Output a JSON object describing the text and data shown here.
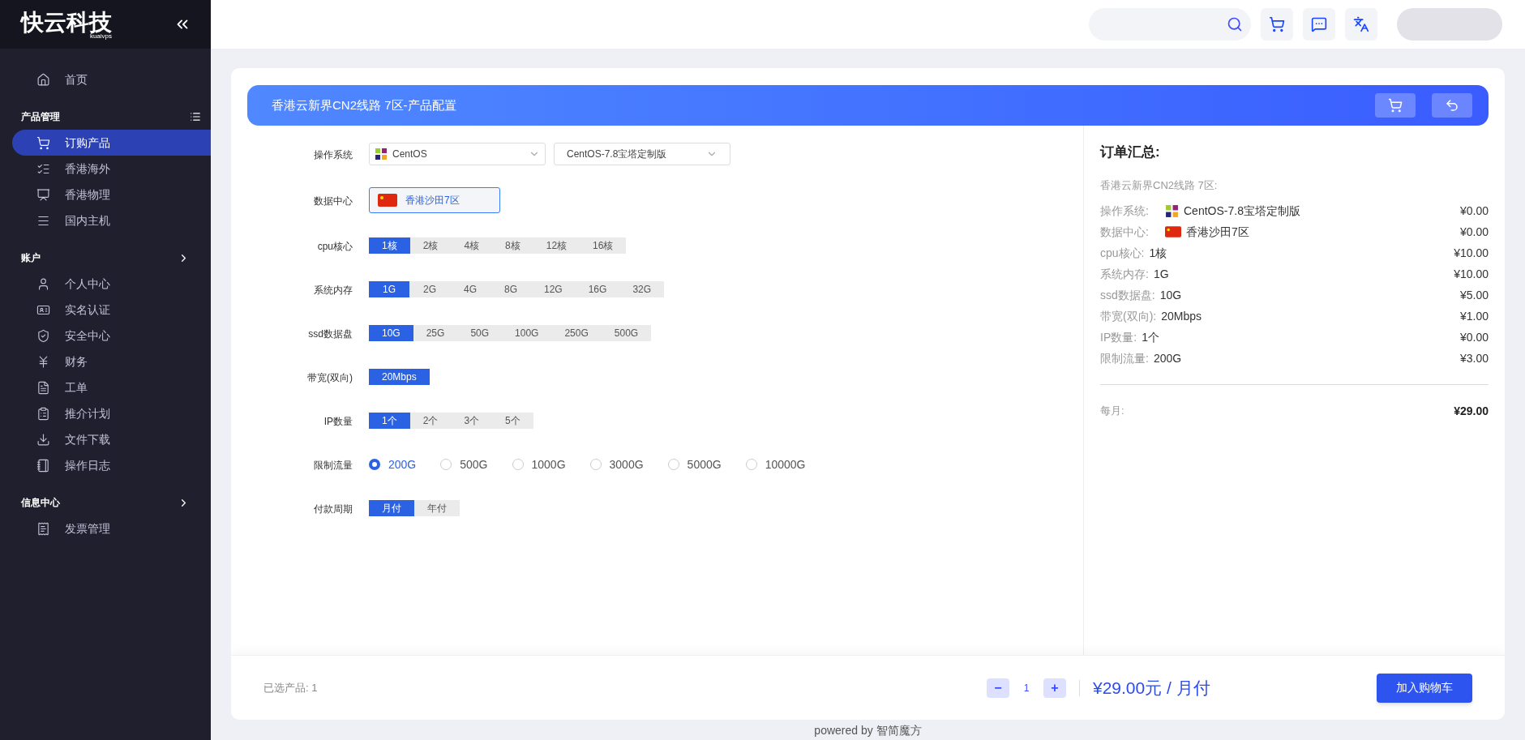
{
  "sidebar": {
    "logo": {
      "text": "快云科技",
      "subtitle": "kuaivps"
    },
    "sections": [
      {
        "items": [
          {
            "label": "首页",
            "selected": false
          }
        ]
      },
      {
        "title": "产品管理",
        "kind": "list",
        "items": [
          {
            "label": "订购产品",
            "selected": true
          },
          {
            "label": "香港海外",
            "selected": false
          },
          {
            "label": "香港物理",
            "selected": false
          },
          {
            "label": "国内主机",
            "selected": false
          }
        ]
      },
      {
        "title": "账户",
        "kind": "expand",
        "items": [
          {
            "label": "个人中心",
            "selected": false
          },
          {
            "label": "实名认证",
            "selected": false
          },
          {
            "label": "安全中心",
            "selected": false
          },
          {
            "label": "财务",
            "selected": false
          },
          {
            "label": "工单",
            "selected": false
          },
          {
            "label": "推介计划",
            "selected": false
          },
          {
            "label": "文件下载",
            "selected": false
          },
          {
            "label": "操作日志",
            "selected": false
          }
        ]
      },
      {
        "title": "信息中心",
        "kind": "expand",
        "items": [
          {
            "label": "发票管理",
            "selected": false
          }
        ]
      }
    ]
  },
  "banner": {
    "title": "香港云新界CN2线路 7区-产品配置"
  },
  "form": {
    "os": {
      "label": "操作系统",
      "family": "CentOS",
      "version": "CentOS-7.8宝塔定制版"
    },
    "datacenter": {
      "label": "数据中心",
      "value": "香港沙田7区"
    },
    "groups": [
      {
        "label": "cpu核心",
        "kind": "segmented",
        "options": [
          {
            "label": "1核",
            "selected": true
          },
          {
            "label": "2核",
            "selected": false
          },
          {
            "label": "4核",
            "selected": false
          },
          {
            "label": "8核",
            "selected": false
          },
          {
            "label": "12核",
            "selected": false
          },
          {
            "label": "16核",
            "selected": false
          }
        ]
      },
      {
        "label": "系统内存",
        "kind": "segmented",
        "options": [
          {
            "label": "1G",
            "selected": true
          },
          {
            "label": "2G",
            "selected": false
          },
          {
            "label": "4G",
            "selected": false
          },
          {
            "label": "8G",
            "selected": false
          },
          {
            "label": "12G",
            "selected": false
          },
          {
            "label": "16G",
            "selected": false
          },
          {
            "label": "32G",
            "selected": false
          }
        ]
      },
      {
        "label": "ssd数据盘",
        "kind": "segmented",
        "options": [
          {
            "label": "10G",
            "selected": true
          },
          {
            "label": "25G",
            "selected": false
          },
          {
            "label": "50G",
            "selected": false
          },
          {
            "label": "100G",
            "selected": false
          },
          {
            "label": "250G",
            "selected": false
          },
          {
            "label": "500G",
            "selected": false
          }
        ]
      },
      {
        "label": "带宽(双向)",
        "kind": "segmented",
        "options": [
          {
            "label": "20Mbps",
            "selected": true
          }
        ]
      },
      {
        "label": "IP数量",
        "kind": "segmented",
        "options": [
          {
            "label": "1个",
            "selected": true
          },
          {
            "label": "2个",
            "selected": false
          },
          {
            "label": "3个",
            "selected": false
          },
          {
            "label": "5个",
            "selected": false
          }
        ]
      },
      {
        "label": "限制流量",
        "kind": "radio",
        "options": [
          {
            "label": "200G",
            "selected": true
          },
          {
            "label": "500G",
            "selected": false
          },
          {
            "label": "1000G",
            "selected": false
          },
          {
            "label": "3000G",
            "selected": false
          },
          {
            "label": "5000G",
            "selected": false
          },
          {
            "label": "10000G",
            "selected": false
          }
        ]
      },
      {
        "label": "付款周期",
        "kind": "segmented",
        "options": [
          {
            "label": "月付",
            "selected": true
          },
          {
            "label": "年付",
            "selected": false
          }
        ]
      }
    ]
  },
  "summary": {
    "title": "订单汇总:",
    "product": "香港云新界CN2线路 7区:",
    "rows": [
      {
        "kind": "os",
        "label": "操作系统:",
        "value": "CentOS-7.8宝塔定制版",
        "price": "¥0.00"
      },
      {
        "kind": "flag",
        "label": "数据中心:",
        "value": "香港沙田7区",
        "price": "¥0.00"
      },
      {
        "kind": "plain",
        "label": "cpu核心:",
        "value": "1核",
        "price": "¥10.00"
      },
      {
        "kind": "plain",
        "label": "系统内存:",
        "value": "1G",
        "price": "¥10.00"
      },
      {
        "kind": "plain",
        "label": "ssd数据盘:",
        "value": "10G",
        "price": "¥5.00"
      },
      {
        "kind": "plain",
        "label": "带宽(双向):",
        "value": "20Mbps",
        "price": "¥1.00"
      },
      {
        "kind": "plain",
        "label": "IP数量:",
        "value": "1个",
        "price": "¥0.00"
      },
      {
        "kind": "plain",
        "label": "限制流量:",
        "value": "200G",
        "price": "¥3.00"
      }
    ],
    "total_label": "每月:",
    "total": "¥29.00"
  },
  "footer": {
    "selected": "已选产品: 1",
    "minus": "−",
    "quantity": "1",
    "plus": "+",
    "price": "¥29.00元 / 月付",
    "button": "加入购物车"
  },
  "powered": "powered by 智简魔方"
}
